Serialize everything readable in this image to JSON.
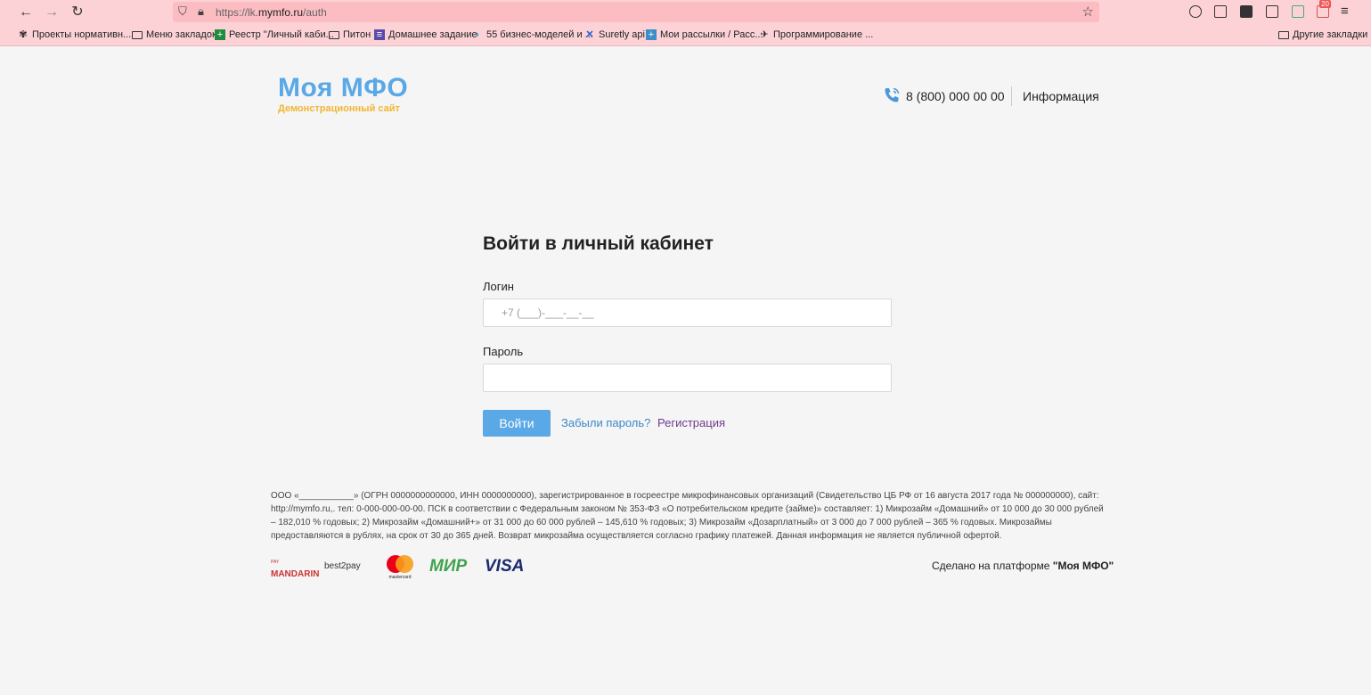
{
  "browser": {
    "url_prefix": "https://lk.",
    "url_domain": "mymfo.ru",
    "url_path": "/auth",
    "extension_badge": "20",
    "bookmarks": [
      "Проекты нормативн...",
      "Меню закладок",
      "Реестр \"Личный каби...",
      "Питон",
      "Домашнее задание",
      "55 бизнес-моделей и ...",
      "Suretly api",
      "Мои рассылки / Расс...",
      "Программирование ..."
    ],
    "other_bookmarks": "Другие закладки"
  },
  "header": {
    "logo_title": "Моя МФО",
    "logo_subtitle": "Демонстрационный сайт",
    "phone": "8 (800) 000 00 00",
    "info_link": "Информация"
  },
  "form": {
    "title": "Войти в личный кабинет",
    "login_label": "Логин",
    "login_placeholder": "+7 (___)-___-__-__",
    "password_label": "Пароль",
    "submit": "Войти",
    "forgot": "Забыли пароль?",
    "register": "Регистрация"
  },
  "footer": {
    "disclaimer": "ООО «___________» (ОГРН 0000000000000, ИНН 0000000000), зарегистрированное в госреестре микрофинансовых организаций (Свидетельство ЦБ РФ от 16 августа 2017 года № 000000000), сайт: http://mymfo.ru,. тел: 0-000-000-00-00. ПСК в соответствии с Федеральным законом № 353-ФЗ «О потребительском кредите (займе)» составляет: 1) Микрозайм «Домашний» от 10 000 до 30 000 рублей – 182,010 % годовых; 2) Микрозайм «Домашний+» от 31 000 до 60 000 рублей – 145,610 % годовых; 3) Микрозайм «Дозарплатный» от 3 000 до 7 000 рублей – 365 % годовых. Микрозаймы предоставляются в рублях, на срок от 30 до 365 дней. Возврат микрозайма осуществляется согласно графику платежей. Данная информация не является публичной офертой.",
    "payments": {
      "mandarin_small": "PAY",
      "mandarin": "MANDARIN",
      "best2pay": "best2pay",
      "mastercard": "mastercard",
      "mir": "МИР",
      "visa": "VISA"
    },
    "made_on_prefix": "Сделано на платформе ",
    "made_on_brand": "\"Моя МФО\""
  },
  "colors": {
    "accent": "#5aa8e6",
    "subtitle": "#f2b632",
    "chrome_bg": "#fcd2d6"
  }
}
